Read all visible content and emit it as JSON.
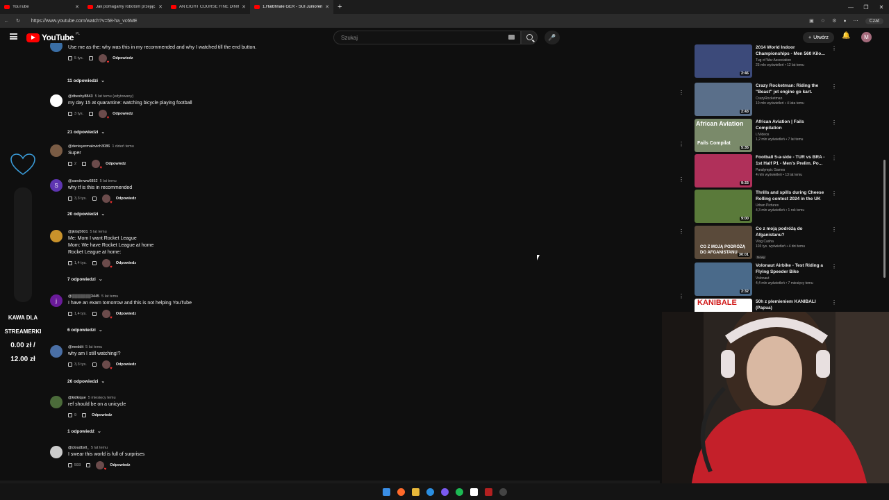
{
  "browser": {
    "tabs": [
      {
        "label": "YouTube",
        "active": false
      },
      {
        "label": "Jak pomagamy robotom przejąć...",
        "active": false
      },
      {
        "label": "AN EIGHT COURSE FINE DINING M...",
        "active": false
      },
      {
        "label": "1.Halbfinale GER - SUI Junioren El...",
        "active": true
      }
    ],
    "url": "https://www.youtube.com/watch?v=58-ha_vc6ME",
    "chat_label": "Czat"
  },
  "youtube": {
    "logo": "YouTube",
    "logo_region": "PL",
    "search_placeholder": "Szukaj",
    "create_label": "Utwórz",
    "avatar_letter": "M"
  },
  "overlay": {
    "kawa_line1": "KAWA DLA",
    "kawa_line2": "STREAMERKI",
    "amount_line1": "0.00 zł /",
    "amount_line2": "12.00 zł"
  },
  "comments": [
    {
      "text": "Use me as the: why was this in my recommended and why I watched till the end button.",
      "author": "",
      "time": "",
      "likes": "5 tys.",
      "reply_label": "Odpowiedz",
      "avatar": "",
      "avatar_color": "#3a6ea5",
      "replies": "11 odpowiedzi"
    },
    {
      "author": "@dbeshy8843",
      "time": "5 lat temu (edytowany)",
      "text": "my day 15 at quarantine: watching bicycle playing football",
      "likes": "3 tys.",
      "reply_label": "Odpowiedz",
      "avatar": "",
      "avatar_color": "#ffffff",
      "replies": "21 odpowiedzi"
    },
    {
      "author": "@denisyermalovich3086",
      "time": "1 dzień temu",
      "text": "Super",
      "likes": "2",
      "reply_label": "Odpowiedz",
      "avatar": "",
      "avatar_color": "#7a5c45",
      "replies": ""
    },
    {
      "author": "@sanderww6852",
      "time": "5 lat temu",
      "text": "why tf is this in recommended",
      "likes": "3,3 tys.",
      "reply_label": "Odpowiedz",
      "avatar": "S",
      "avatar_color": "#5e35b1",
      "replies": "20 odpowiedzi"
    },
    {
      "author": "@jkitsj5601",
      "time": "5 lat temu",
      "text": "Me: Mom I want Rocket League",
      "text2": "Mom: We have Rocket League at home",
      "text3": "Rocket League at home:",
      "likes": "1,4 tys.",
      "reply_label": "Odpowiedz",
      "avatar": "",
      "avatar_color": "#c9922b",
      "replies": "7 odpowiedzi"
    },
    {
      "author": "@▒▒▒▒▒▒▒3445",
      "time": "5 lat temu",
      "text": "I have an exam tomorrow and this is not helping YouTube",
      "likes": "1,4 tys.",
      "reply_label": "Odpowiedz",
      "avatar": "j",
      "avatar_color": "#6a1b9a",
      "replies": "6 odpowiedzi"
    },
    {
      "author": "@meddit",
      "time": "5 lat temu",
      "text": "why am I still watching!?",
      "likes": "3,3 tys.",
      "reply_label": "Odpowiedz",
      "avatar": "",
      "avatar_color": "#4a6fa5",
      "replies": "26 odpowiedzi"
    },
    {
      "author": "@kidkique",
      "time": "5 miesięcy temu",
      "text": "ref should be on a unicycle",
      "likes": "9",
      "reply_label": "Odpowiedz",
      "avatar": "",
      "avatar_color": "#4b6b3a",
      "replies": "1 odpowiedź"
    },
    {
      "author": "@cloudbxll_",
      "time": "5 lat temu",
      "text": "I swear this world is full of surprises",
      "likes": "593",
      "reply_label": "Odpowiedz",
      "avatar": "",
      "avatar_color": "#cccccc",
      "replies": ""
    }
  ],
  "related": [
    {
      "title": "2014 World Indoor Championships - Men 560 Kilo...",
      "channel": "Tug of War Association",
      "stats": "23 mln wyświetleń • 12 lat temu",
      "duration": "2:46",
      "badge": "",
      "thumb_color": "#3c4a7a"
    },
    {
      "title": "Crazy Rocketman: Riding the \"Beast\" jet engine go kart.",
      "channel": "CrazyRocketman",
      "stats": "10 mln wyświetleń • 4 lata temu",
      "duration": "2:43",
      "badge": "",
      "thumb_color": "#5a6f8a"
    },
    {
      "title": "African Aviation | Fails Compilation",
      "channel": "LIVideos",
      "stats": "1,2 mln wyświetleń • 7 lat temu",
      "duration": "5:35",
      "badge": "",
      "thumb_color": "#7a8a6a",
      "thumb_text": "African Aviation",
      "thumb_text2": "Fails Compilat"
    },
    {
      "title": "Football 5-a-side - TUR vs BRA - 1st Half P1 - Men's Prelim. Po...",
      "channel": "Paralympic Games",
      "stats": "4 mln wyświetleń • 13 lat temu",
      "duration": "9:33",
      "badge": "",
      "thumb_color": "#b0305a"
    },
    {
      "title": "Thrills and spills during Cheese Rolling contest 2024 in the UK",
      "channel": "Urban Pictures",
      "stats": "4,3 mln wyświetleń • 1 rok temu",
      "duration": "9:00",
      "badge": "",
      "thumb_color": "#5a7a3a"
    },
    {
      "title": "Co z moją podróżą do Afganistanu?",
      "channel": "Vlog Casha",
      "stats": "103 tys. wyświetleń • 4 dni temu",
      "duration": "30:01",
      "badge": "Nowy",
      "thumb_color": "#5a4a3a",
      "thumb_text": "CO Z MOJĄ PODRÓŻĄ",
      "thumb_text2": "DO AFGANISTANU"
    },
    {
      "title": "Volonaut Airbike - Test Riding a Flying Speeder Bike",
      "channel": "Volonaut",
      "stats": "4,4 mln wyświetleń • 7 miesięcy temu",
      "duration": "2:32",
      "badge": "",
      "thumb_color": "#4a6a8a"
    },
    {
      "title": "50h z plemieniem KANIBALI (Papua)",
      "channel": "",
      "stats": "",
      "duration": "",
      "badge": "",
      "thumb_color": "#ffffff",
      "thumb_text": "KANIBALE"
    }
  ]
}
